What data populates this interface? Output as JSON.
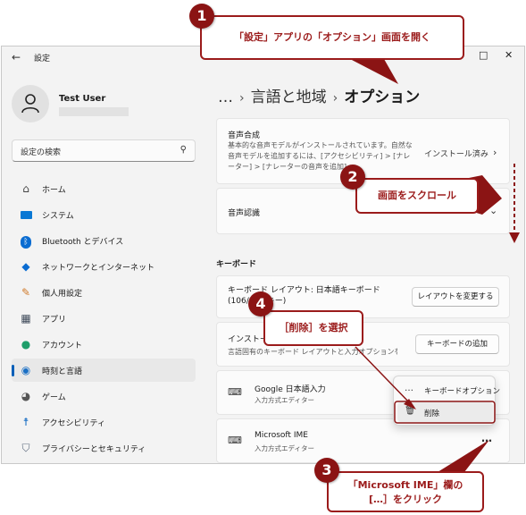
{
  "window": {
    "title": "設定",
    "back_icon": "back-arrow-icon",
    "controls": [
      "minimize-icon",
      "maximize-icon",
      "close-icon"
    ]
  },
  "user": {
    "name": "Test User"
  },
  "search": {
    "placeholder": "設定の検索",
    "icon": "search-icon"
  },
  "nav": {
    "items": [
      {
        "label": "ホーム",
        "icon": "home-icon",
        "active": false
      },
      {
        "label": "システム",
        "icon": "system-icon",
        "active": false
      },
      {
        "label": "Bluetooth とデバイス",
        "icon": "bluetooth-icon",
        "active": false
      },
      {
        "label": "ネットワークとインターネット",
        "icon": "wifi-icon",
        "active": false
      },
      {
        "label": "個人用設定",
        "icon": "brush-icon",
        "active": false
      },
      {
        "label": "アプリ",
        "icon": "apps-icon",
        "active": false
      },
      {
        "label": "アカウント",
        "icon": "account-icon",
        "active": false
      },
      {
        "label": "時刻と言語",
        "icon": "time-language-icon",
        "active": true
      },
      {
        "label": "ゲーム",
        "icon": "game-icon",
        "active": false
      },
      {
        "label": "アクセシビリティ",
        "icon": "accessibility-icon",
        "active": false
      },
      {
        "label": "プライバシーとセキュリティ",
        "icon": "shield-icon",
        "active": false
      }
    ]
  },
  "breadcrumb": {
    "ellipsis": "…",
    "parent": "言語と地域",
    "current": "オプション"
  },
  "speech_synthesis": {
    "title": "音声合成",
    "description": "基本的な音声モデルがインストールされています。自然な音声モデルを追加するには、[アクセシビリティ] > [ナレーター] > [ナレーターの音声を追加]",
    "status": "インストール済み"
  },
  "speech_recognition": {
    "title": "音声認識"
  },
  "keyboard_section": {
    "label": "キーボード"
  },
  "keyboard_layout": {
    "title": "キーボード レイアウト: 日本語キーボード (106/109 キー)",
    "button": "レイアウトを変更する"
  },
  "installed_keyboards": {
    "title": "インストール済みキーボード",
    "description": "言語固有のキーボード レイアウトと入力オプションを管理します",
    "button": "キーボードの追加"
  },
  "ime_list": [
    {
      "name": "Google 日本語入力",
      "subtitle": "入力方式エディター"
    },
    {
      "name": "Microsoft IME",
      "subtitle": "入力方式エディター"
    }
  ],
  "more_button": "…",
  "flyout": {
    "items": [
      {
        "label": "キーボードオプション",
        "icon": "more-icon"
      },
      {
        "label": "削除",
        "icon": "trash-icon"
      }
    ]
  },
  "annotations": {
    "step1": {
      "number": "1",
      "text": "「設定」アプリの「オプション」画面を開く"
    },
    "step2": {
      "number": "2",
      "text": "画面をスクロール"
    },
    "step3": {
      "number": "3",
      "text_line1": "「Microsoft IME」欄の",
      "text_line2": "[…］をクリック"
    },
    "step4": {
      "number": "4",
      "text": "［削除］を選択"
    },
    "color": "#8b1414"
  }
}
